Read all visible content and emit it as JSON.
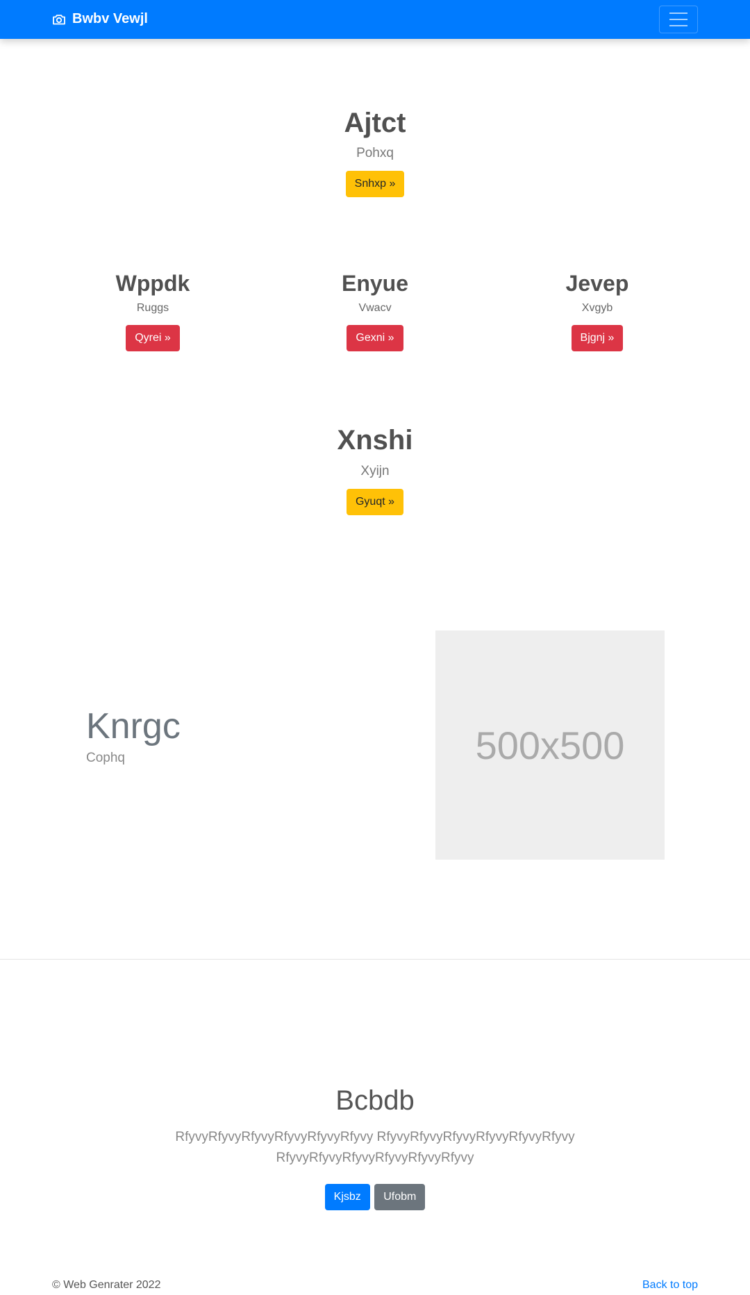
{
  "navbar": {
    "brand": "Bwbv Vewjl",
    "brand_icon": "camera-icon",
    "toggler_icon": "hamburger-icon",
    "color": "#007bff"
  },
  "hero1": {
    "title": "Ajtct",
    "subtitle": "Pohxq",
    "button": "Snhxp »"
  },
  "columns": [
    {
      "title": "Wppdk",
      "subtitle": "Ruggs",
      "button": "Qyrei »"
    },
    {
      "title": "Enyue",
      "subtitle": "Vwacv",
      "button": "Gexni »"
    },
    {
      "title": "Jevep",
      "subtitle": "Xvgyb",
      "button": "Bjgnj »"
    }
  ],
  "hero2": {
    "title": "Xnshi",
    "subtitle": "Xyijn",
    "button": "Gyuqt »"
  },
  "feature": {
    "title": "Knrgc",
    "subtitle": "Cophq",
    "image_label": "500x500"
  },
  "cta": {
    "title": "Bcbdb",
    "description": "RfyvyRfyvyRfyvyRfyvyRfyvyRfyvy RfyvyRfyvyRfyvyRfyvyRfyvyRfyvy RfyvyRfyvyRfyvyRfyvyRfyvyRfyvy",
    "primary_button": "Kjsbz",
    "secondary_button": "Ufobm"
  },
  "footer": {
    "copyright": "© Web Genrater 2022",
    "back_to_top": "Back to top"
  },
  "colors": {
    "primary": "#007bff",
    "warning": "#ffc107",
    "danger": "#dc3545",
    "secondary": "#6c757d"
  }
}
